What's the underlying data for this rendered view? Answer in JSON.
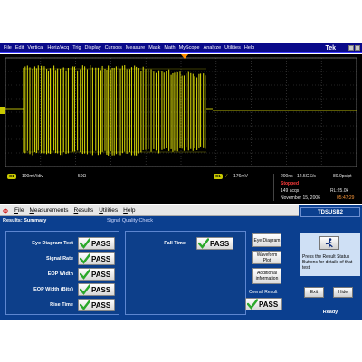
{
  "scope": {
    "menu": [
      "File",
      "Edit",
      "Vertical",
      "Horiz/Acq",
      "Trig",
      "Display",
      "Cursors",
      "Measure",
      "Mask",
      "Math",
      "MyScope",
      "Analyze",
      "Utilities",
      "Help"
    ],
    "brand": "Tek",
    "status": {
      "ch1_badge": "C1",
      "ch1_scale": "100mV/div",
      "ch1_impedance": "50Ω",
      "trig_badge": "C1",
      "trig_level": "176mV",
      "timebase": "200ns",
      "sample_rate": "12.5GS/s",
      "pts": "80.0ps/pt",
      "mode": "Stopped",
      "acqs": "149 acqs",
      "record_length": "RL:25.0k",
      "date": "November 15, 2006",
      "time": "05:47:29"
    }
  },
  "app": {
    "menu": [
      {
        "u": "F",
        "rest": "ile"
      },
      {
        "u": "M",
        "rest": "easurements"
      },
      {
        "u": "R",
        "rest": "esults"
      },
      {
        "u": "U",
        "rest": "tilities"
      },
      {
        "u": "H",
        "rest": "elp"
      }
    ],
    "subheader_left": "Results: Summary",
    "subheader_mid": "Signal Quality Check",
    "tests_left": [
      {
        "label": "Eye Diagram Test",
        "result": "PASS"
      },
      {
        "label": "Signal Rate",
        "result": "PASS"
      },
      {
        "label": "EOP Width",
        "result": "PASS"
      },
      {
        "label": "EOP Width (Bits)",
        "result": "PASS"
      },
      {
        "label": "Rise Time",
        "result": "PASS"
      }
    ],
    "tests_right": [
      {
        "label": "Fall Time",
        "result": "PASS"
      }
    ],
    "side_buttons": {
      "eye_diagram": "Eye Diagram",
      "waveform_plot": "Waveform Plot",
      "additional_info": "Additional information"
    },
    "overall_label": "Overall Result",
    "overall_result": "PASS"
  },
  "tds": {
    "title": "TDSUSB2",
    "description": "Press the Result Status Buttons for details of that test.",
    "exit": "Exit",
    "hide": "Hide",
    "status": "Ready"
  },
  "colors": {
    "trace": "#f2f20a",
    "panel_blue": "#0b3f8f",
    "pass_check": "#2aa82a"
  }
}
